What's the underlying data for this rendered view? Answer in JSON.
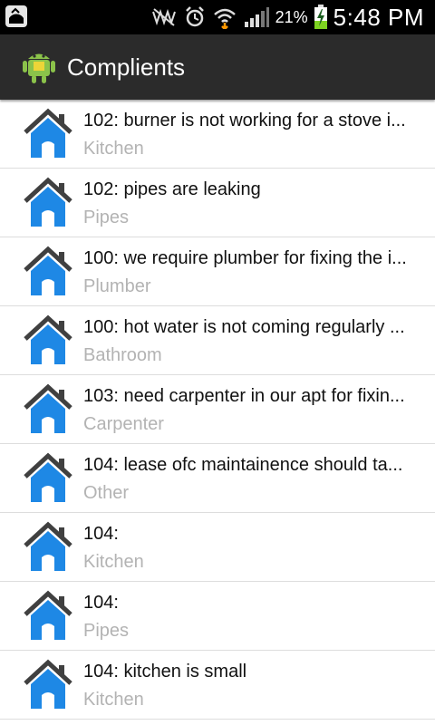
{
  "status_bar": {
    "battery_text": "21%",
    "time": "5:48 PM",
    "icons": [
      "screenshot-icon",
      "vibrate-icon",
      "alarm-icon",
      "wifi-icon",
      "signal-icon",
      "battery-charging-icon"
    ]
  },
  "action_bar": {
    "title": "Complients",
    "icon": "android-app-icon"
  },
  "accent_color": "#1e88e5",
  "list": [
    {
      "title": "102: burner is not working for a stove i...",
      "category": "Kitchen"
    },
    {
      "title": "102: pipes are leaking",
      "category": "Pipes"
    },
    {
      "title": "100: we require plumber for fixing the i...",
      "category": "Plumber"
    },
    {
      "title": "100: hot water is not coming regularly ...",
      "category": "Bathroom"
    },
    {
      "title": "103: need carpenter in our apt for fixin...",
      "category": "Carpenter"
    },
    {
      "title": "104: lease ofc maintainence should ta...",
      "category": "Other"
    },
    {
      "title": "104:",
      "category": "Kitchen"
    },
    {
      "title": "104:",
      "category": "Pipes"
    },
    {
      "title": "104: kitchen is small",
      "category": "Kitchen"
    }
  ]
}
